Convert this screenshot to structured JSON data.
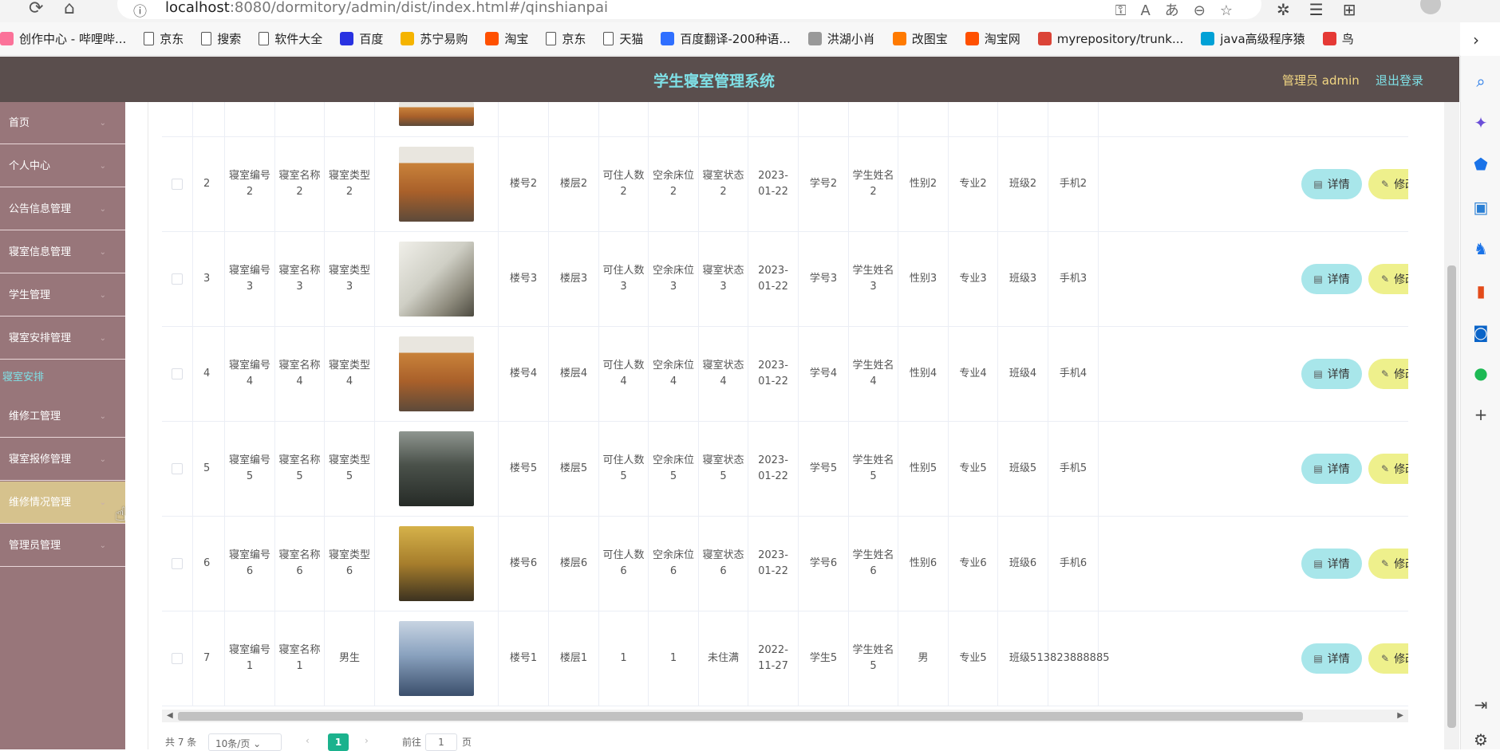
{
  "browser": {
    "url_host": "localhost",
    "url_rest": ":8080/dormitory/admin/dist/index.html#/qinshianpai",
    "bookmarks": [
      {
        "label": "创作中心 - 哔哩哔...",
        "icon": "bilibili-icon",
        "color": "#fb7299"
      },
      {
        "label": "京东",
        "icon": "page-icon"
      },
      {
        "label": "搜索",
        "icon": "page-icon"
      },
      {
        "label": "软件大全",
        "icon": "page-icon"
      },
      {
        "label": "百度",
        "icon": "baidu-paw-icon",
        "color": "#2932e1"
      },
      {
        "label": "苏宁易购",
        "icon": "suning-icon",
        "color": "#f5b400"
      },
      {
        "label": "淘宝",
        "icon": "taobao-icon",
        "color": "#ff5000"
      },
      {
        "label": "京东",
        "icon": "page-icon"
      },
      {
        "label": "天猫",
        "icon": "page-icon"
      },
      {
        "label": "百度翻译-200种语...",
        "icon": "fanyi-icon",
        "color": "#2f6fff"
      },
      {
        "label": "洪湖小肖",
        "icon": "feather-icon",
        "color": "#999999"
      },
      {
        "label": "改图宝",
        "icon": "gaitubao-icon",
        "color": "#ff7a00"
      },
      {
        "label": "淘宝网",
        "icon": "taobao-icon",
        "color": "#ff5000"
      },
      {
        "label": "myrepository/trunk...",
        "icon": "chrome-icon",
        "color": "#db4437"
      },
      {
        "label": "java高级程序猿",
        "icon": "bilibili-tv-icon",
        "color": "#00a1d6"
      },
      {
        "label": "鸟",
        "icon": "bird-icon",
        "color": "#e53935"
      }
    ]
  },
  "app": {
    "title": "学生寝室管理系统",
    "user": "管理员 admin",
    "logout": "退出登录"
  },
  "nav": {
    "items": [
      "首页",
      "个人中心",
      "公告信息管理",
      "寝室信息管理",
      "学生管理",
      "寝室安排管理"
    ],
    "sub_item": "寝室安排",
    "items2": [
      "维修工管理",
      "寝室报修管理",
      "维修情况管理",
      "管理员管理"
    ]
  },
  "table": {
    "detail_label": "详情",
    "edit_label": "修改",
    "rows": [
      {
        "idx": "2",
        "bianhao": "寝室编号2",
        "mingcheng": "寝室名称2",
        "leixing": "寝室类型2",
        "loudong": "楼号2",
        "louceng": "楼层2",
        "keru": "可住人数2",
        "kongyu": "空余床位2",
        "zhuangtai": "寝室状态2",
        "date": "2023-01-22",
        "xuehao": "学号2",
        "xingming": "学生姓名2",
        "xingbie": "性别2",
        "zhuanye": "专业2",
        "banji": "班级2",
        "shouji": "手机2",
        "photo": "bunk-orange"
      },
      {
        "idx": "3",
        "bianhao": "寝室编号3",
        "mingcheng": "寝室名称3",
        "leixing": "寝室类型3",
        "loudong": "楼号3",
        "louceng": "楼层3",
        "keru": "可住人数3",
        "kongyu": "空余床位3",
        "zhuangtai": "寝室状态3",
        "date": "2023-01-22",
        "xuehao": "学号3",
        "xingming": "学生姓名3",
        "xingbie": "性别3",
        "zhuanye": "专业3",
        "banji": "班级3",
        "shouji": "手机3",
        "photo": "bunk-white"
      },
      {
        "idx": "4",
        "bianhao": "寝室编号4",
        "mingcheng": "寝室名称4",
        "leixing": "寝室类型4",
        "loudong": "楼号4",
        "louceng": "楼层4",
        "keru": "可住人数4",
        "kongyu": "空余床位4",
        "zhuangtai": "寝室状态4",
        "date": "2023-01-22",
        "xuehao": "学号4",
        "xingming": "学生姓名4",
        "xingbie": "性别4",
        "zhuanye": "专业4",
        "banji": "班级4",
        "shouji": "手机4",
        "photo": "bunk-orange"
      },
      {
        "idx": "5",
        "bianhao": "寝室编号5",
        "mingcheng": "寝室名称5",
        "leixing": "寝室类型5",
        "loudong": "楼号5",
        "louceng": "楼层5",
        "keru": "可住人数5",
        "kongyu": "空余床位5",
        "zhuangtai": "寝室状态5",
        "date": "2023-01-22",
        "xuehao": "学号5",
        "xingming": "学生姓名5",
        "xingbie": "性别5",
        "zhuanye": "专业5",
        "banji": "班级5",
        "shouji": "手机5",
        "photo": "dorm-dark"
      },
      {
        "idx": "6",
        "bianhao": "寝室编号6",
        "mingcheng": "寝室名称6",
        "leixing": "寝室类型6",
        "loudong": "楼号6",
        "louceng": "楼层6",
        "keru": "可住人数6",
        "kongyu": "空余床位6",
        "zhuangtai": "寝室状态6",
        "date": "2023-01-22",
        "xuehao": "学号6",
        "xingming": "学生姓名6",
        "xingbie": "性别6",
        "zhuanye": "专业6",
        "banji": "班级6",
        "shouji": "手机6",
        "photo": "dorm-yellow"
      },
      {
        "idx": "7",
        "bianhao": "寝室编号1",
        "mingcheng": "寝室名称1",
        "leixing": "男生",
        "loudong": "楼号1",
        "louceng": "楼层1",
        "keru": "1",
        "kongyu": "1",
        "zhuangtai": "未住满",
        "date": "2022-11-27",
        "xuehao": "学生5",
        "xingming": "学生姓名5",
        "xingbie": "男",
        "zhuanye": "专业5",
        "banji": "班级5",
        "shouji": "13823888885",
        "photo": "dorm-blue"
      }
    ]
  },
  "pager": {
    "total": "共 7 条",
    "size": "10条/页",
    "page": "1",
    "goto_label": "前往",
    "goto_value": "1",
    "page_suffix": "页"
  }
}
